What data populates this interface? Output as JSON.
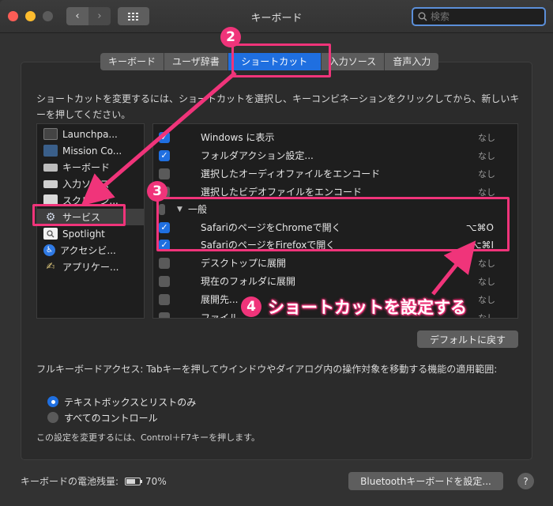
{
  "window": {
    "title": "キーボード"
  },
  "search": {
    "placeholder": "検索"
  },
  "tabs": [
    {
      "label": "キーボード"
    },
    {
      "label": "ユーザ辞書"
    },
    {
      "label": "ショートカット"
    },
    {
      "label": "入力ソース"
    },
    {
      "label": "音声入力"
    }
  ],
  "description": "ショートカットを変更するには、ショートカットを選択し、キーコンビネーションをクリックしてから、新しいキーを押してください。",
  "categories": [
    {
      "label": "Launchpa...",
      "icon": "launchpad-icon"
    },
    {
      "label": "Mission Co...",
      "icon": "mission-control-icon"
    },
    {
      "label": "キーボード",
      "icon": "keyboard-icon"
    },
    {
      "label": "入力ソース",
      "icon": "input-source-icon"
    },
    {
      "label": "スクリーン...",
      "icon": "screenshot-icon"
    },
    {
      "label": "サービス",
      "icon": "gear-icon"
    },
    {
      "label": "Spotlight",
      "icon": "spotlight-icon"
    },
    {
      "label": "アクセシビ...",
      "icon": "accessibility-icon"
    },
    {
      "label": "アプリケー...",
      "icon": "app-shortcuts-icon"
    }
  ],
  "shortcuts": [
    {
      "label": "Windows に表示",
      "shortcut": "なし",
      "checked": true
    },
    {
      "label": "フォルダアクション設定...",
      "shortcut": "なし",
      "checked": true
    },
    {
      "label": "選択したオーディオファイルをエンコード",
      "shortcut": "なし",
      "checked": false
    },
    {
      "label": "選択したビデオファイルをエンコード",
      "shortcut": "なし",
      "checked": false
    },
    {
      "label": "一般",
      "group": true
    },
    {
      "label": "SafariのページをChromeで開く",
      "shortcut": "⌥⌘O",
      "checked": true
    },
    {
      "label": "SafariのページをFirefoxで開く",
      "shortcut": "⌥⌘I",
      "checked": true
    },
    {
      "label": "デスクトップに展開",
      "shortcut": "なし",
      "checked": false
    },
    {
      "label": "現在のフォルダに展開",
      "shortcut": "なし",
      "checked": false
    },
    {
      "label": "展開先...",
      "shortcut": "なし",
      "checked": false
    },
    {
      "label": "ファイル...",
      "shortcut": "なし",
      "checked": false
    }
  ],
  "buttons": {
    "restore_defaults": "デフォルトに戻す",
    "bluetooth": "Bluetoothキーボードを設定...",
    "help": "?"
  },
  "full_keyboard_access": {
    "text": "フルキーボードアクセス: Tabキーを押してウインドウやダイアログ内の操作対象を移動する機能の適用範囲:",
    "options": [
      {
        "label": "テキストボックスとリストのみ",
        "selected": true
      },
      {
        "label": "すべてのコントロール",
        "selected": false
      }
    ],
    "note": "この設定を変更するには、Control＋F7キーを押します。"
  },
  "battery": {
    "label": "キーボードの電池残量:",
    "value": "70%",
    "level": 0.7
  },
  "annotations": {
    "step2": "2",
    "step3": "3",
    "step4": "4",
    "callout": "ショートカットを設定する"
  },
  "colors": {
    "accent": "#1f6fe0",
    "annotation": "#f0347a"
  }
}
